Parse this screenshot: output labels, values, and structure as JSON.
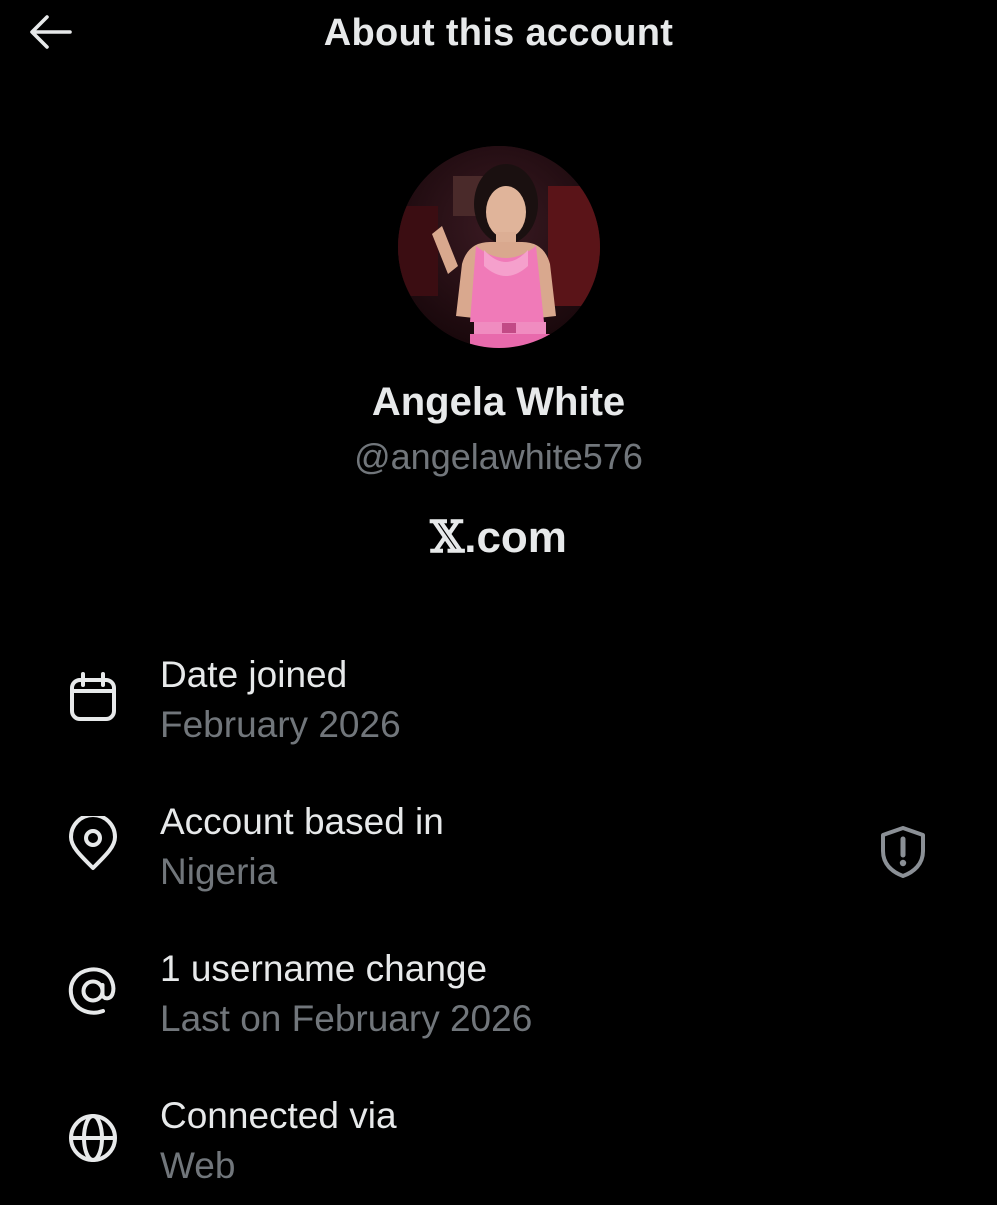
{
  "header": {
    "title": "About this account",
    "back_icon": "arrow-left-icon"
  },
  "profile": {
    "display_name": "Angela White",
    "handle": "@angelawhite576",
    "platform_mark": "𝕏",
    "platform_suffix": ".com",
    "avatar_icon": "profile-photo"
  },
  "details": [
    {
      "icon": "calendar-icon",
      "label": "Date joined",
      "value": "February 2026"
    },
    {
      "icon": "location-pin-icon",
      "label": "Account based in",
      "value": "Nigeria",
      "action_icon": "shield-alert-icon"
    },
    {
      "icon": "at-sign-icon",
      "label": "1 username change",
      "value": "Last on February 2026"
    },
    {
      "icon": "globe-icon",
      "label": "Connected via",
      "value": "Web"
    }
  ],
  "colors": {
    "background": "#000000",
    "primary_text": "#e7e9ea",
    "secondary_text": "#71767b",
    "icon": "#e7e9ea"
  }
}
